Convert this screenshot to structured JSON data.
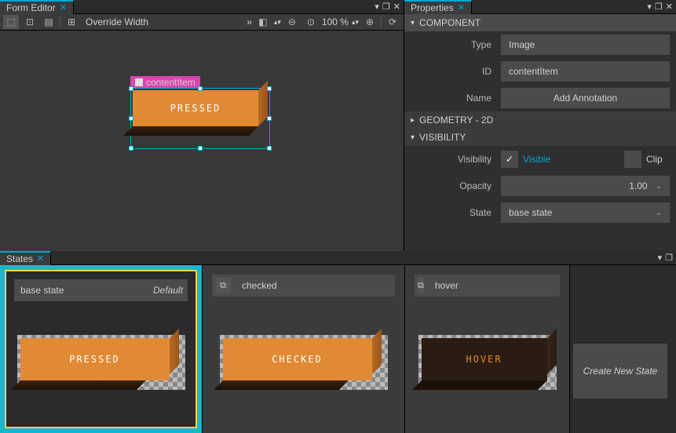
{
  "editor": {
    "tab_title": "Form Editor",
    "override_width": "Override Width",
    "zoom": "100 %",
    "item_label": "contentItem",
    "pressed_label": "PRESSED"
  },
  "properties": {
    "tab_title": "Properties",
    "component_header": "COMPONENT",
    "geometry_header": "GEOMETRY - 2D",
    "visibility_header": "VISIBILITY",
    "type_label": "Type",
    "type_value": "Image",
    "id_label": "ID",
    "id_value": "contentItem",
    "name_label": "Name",
    "add_annotation": "Add Annotation",
    "visibility_label": "Visibility",
    "visible_text": "Visible",
    "clip_text": "Clip",
    "opacity_label": "Opacity",
    "opacity_value": "1.00",
    "state_label": "State",
    "state_value": "base state"
  },
  "states": {
    "tab_title": "States",
    "base": {
      "name": "base state",
      "default": "Default",
      "preview_label": "PRESSED"
    },
    "checked": {
      "name": "checked",
      "preview_label": "CHECKED"
    },
    "hover": {
      "name": "hover",
      "preview_label": "HOVER"
    },
    "create": "Create New State"
  }
}
